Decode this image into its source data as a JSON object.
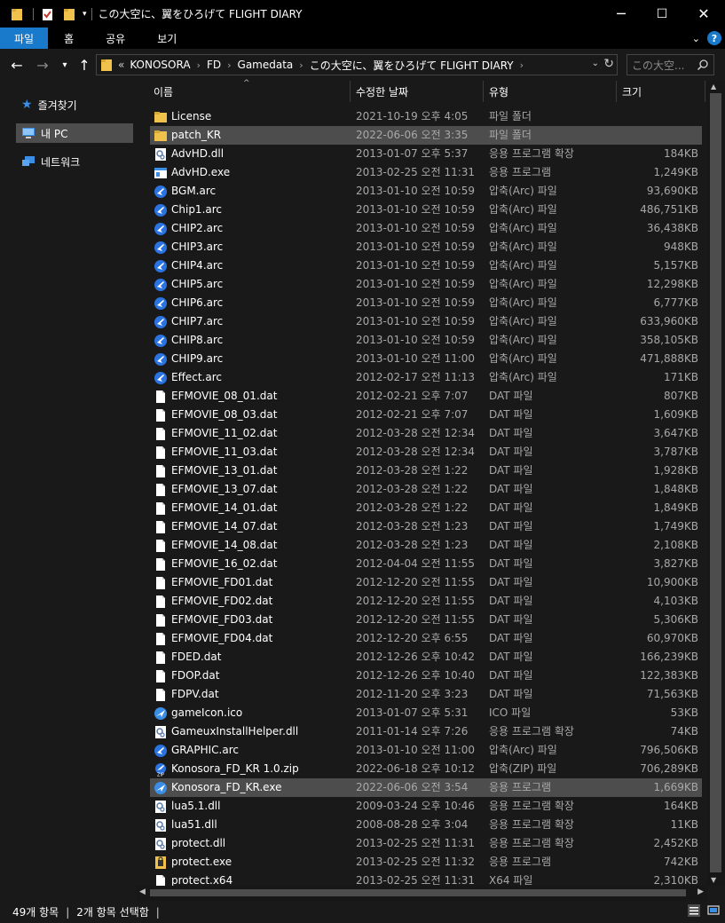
{
  "window": {
    "title": "この大空に、翼をひろげて FLIGHT DIARY",
    "minimize_glyph": "─",
    "maximize_glyph": "☐",
    "close_glyph": "✕"
  },
  "ribbon": {
    "tabs": [
      "파일",
      "홈",
      "공유",
      "보기"
    ],
    "help": "?"
  },
  "address": {
    "prefix": "«",
    "crumbs": [
      "KONOSORA",
      "FD",
      "Gamedata",
      "この大空に、翼をひろげて FLIGHT DIARY"
    ],
    "separator": "›"
  },
  "search": {
    "placeholder": "この大空..."
  },
  "nav": {
    "items": [
      {
        "label": "즐겨찾기",
        "icon": "star-icon"
      },
      {
        "label": "내 PC",
        "icon": "pc-icon"
      },
      {
        "label": "네트워크",
        "icon": "network-icon"
      }
    ]
  },
  "columns": {
    "name": "이름",
    "date": "수정한 날짜",
    "type": "유형",
    "size": "크기"
  },
  "files": [
    {
      "name": "License",
      "date": "2021-10-19 오후 4:05",
      "type": "파일 폴더",
      "size": "",
      "icon": "folder"
    },
    {
      "name": "patch_KR",
      "date": "2022-06-06 오전 3:35",
      "type": "파일 폴더",
      "size": "",
      "icon": "folder",
      "selected": true
    },
    {
      "name": "AdvHD.dll",
      "date": "2013-01-07 오후 5:37",
      "type": "응용 프로그램 확장",
      "size": "184KB",
      "icon": "dll"
    },
    {
      "name": "AdvHD.exe",
      "date": "2013-02-25 오전 11:31",
      "type": "응용 프로그램",
      "size": "1,249KB",
      "icon": "exe"
    },
    {
      "name": "BGM.arc",
      "date": "2013-01-10 오전 10:59",
      "type": "압축(Arc) 파일",
      "size": "93,690KB",
      "icon": "arc"
    },
    {
      "name": "Chip1.arc",
      "date": "2013-01-10 오전 10:59",
      "type": "압축(Arc) 파일",
      "size": "486,751KB",
      "icon": "arc"
    },
    {
      "name": "CHIP2.arc",
      "date": "2013-01-10 오전 10:59",
      "type": "압축(Arc) 파일",
      "size": "36,438KB",
      "icon": "arc"
    },
    {
      "name": "CHIP3.arc",
      "date": "2013-01-10 오전 10:59",
      "type": "압축(Arc) 파일",
      "size": "948KB",
      "icon": "arc"
    },
    {
      "name": "CHIP4.arc",
      "date": "2013-01-10 오전 10:59",
      "type": "압축(Arc) 파일",
      "size": "5,157KB",
      "icon": "arc"
    },
    {
      "name": "CHIP5.arc",
      "date": "2013-01-10 오전 10:59",
      "type": "압축(Arc) 파일",
      "size": "12,298KB",
      "icon": "arc"
    },
    {
      "name": "CHIP6.arc",
      "date": "2013-01-10 오전 10:59",
      "type": "압축(Arc) 파일",
      "size": "6,777KB",
      "icon": "arc"
    },
    {
      "name": "CHIP7.arc",
      "date": "2013-01-10 오전 10:59",
      "type": "압축(Arc) 파일",
      "size": "633,960KB",
      "icon": "arc"
    },
    {
      "name": "CHIP8.arc",
      "date": "2013-01-10 오전 10:59",
      "type": "압축(Arc) 파일",
      "size": "358,105KB",
      "icon": "arc"
    },
    {
      "name": "CHIP9.arc",
      "date": "2013-01-10 오전 11:00",
      "type": "압축(Arc) 파일",
      "size": "471,888KB",
      "icon": "arc"
    },
    {
      "name": "Effect.arc",
      "date": "2012-02-17 오전 11:13",
      "type": "압축(Arc) 파일",
      "size": "171KB",
      "icon": "arc"
    },
    {
      "name": "EFMOVIE_08_01.dat",
      "date": "2012-02-21 오후 7:07",
      "type": "DAT 파일",
      "size": "807KB",
      "icon": "file"
    },
    {
      "name": "EFMOVIE_08_03.dat",
      "date": "2012-02-21 오후 7:07",
      "type": "DAT 파일",
      "size": "1,609KB",
      "icon": "file"
    },
    {
      "name": "EFMOVIE_11_02.dat",
      "date": "2012-03-28 오전 12:34",
      "type": "DAT 파일",
      "size": "3,647KB",
      "icon": "file"
    },
    {
      "name": "EFMOVIE_11_03.dat",
      "date": "2012-03-28 오전 12:34",
      "type": "DAT 파일",
      "size": "3,787KB",
      "icon": "file"
    },
    {
      "name": "EFMOVIE_13_01.dat",
      "date": "2012-03-28 오전 1:22",
      "type": "DAT 파일",
      "size": "1,928KB",
      "icon": "file"
    },
    {
      "name": "EFMOVIE_13_07.dat",
      "date": "2012-03-28 오전 1:22",
      "type": "DAT 파일",
      "size": "1,848KB",
      "icon": "file"
    },
    {
      "name": "EFMOVIE_14_01.dat",
      "date": "2012-03-28 오전 1:22",
      "type": "DAT 파일",
      "size": "1,849KB",
      "icon": "file"
    },
    {
      "name": "EFMOVIE_14_07.dat",
      "date": "2012-03-28 오전 1:23",
      "type": "DAT 파일",
      "size": "1,749KB",
      "icon": "file"
    },
    {
      "name": "EFMOVIE_14_08.dat",
      "date": "2012-03-28 오전 1:23",
      "type": "DAT 파일",
      "size": "2,108KB",
      "icon": "file"
    },
    {
      "name": "EFMOVIE_16_02.dat",
      "date": "2012-04-04 오전 11:55",
      "type": "DAT 파일",
      "size": "3,827KB",
      "icon": "file"
    },
    {
      "name": "EFMOVIE_FD01.dat",
      "date": "2012-12-20 오전 11:55",
      "type": "DAT 파일",
      "size": "10,900KB",
      "icon": "file"
    },
    {
      "name": "EFMOVIE_FD02.dat",
      "date": "2012-12-20 오전 11:55",
      "type": "DAT 파일",
      "size": "4,103KB",
      "icon": "file"
    },
    {
      "name": "EFMOVIE_FD03.dat",
      "date": "2012-12-20 오전 11:55",
      "type": "DAT 파일",
      "size": "5,306KB",
      "icon": "file"
    },
    {
      "name": "EFMOVIE_FD04.dat",
      "date": "2012-12-20 오후 6:55",
      "type": "DAT 파일",
      "size": "60,970KB",
      "icon": "file"
    },
    {
      "name": "FDED.dat",
      "date": "2012-12-26 오후 10:42",
      "type": "DAT 파일",
      "size": "166,239KB",
      "icon": "file"
    },
    {
      "name": "FDOP.dat",
      "date": "2012-12-26 오후 10:40",
      "type": "DAT 파일",
      "size": "122,383KB",
      "icon": "file"
    },
    {
      "name": "FDPV.dat",
      "date": "2012-11-20 오후 3:23",
      "type": "DAT 파일",
      "size": "71,563KB",
      "icon": "file"
    },
    {
      "name": "gameIcon.ico",
      "date": "2013-01-07 오후 5:31",
      "type": "ICO 파일",
      "size": "53KB",
      "icon": "plane"
    },
    {
      "name": "GameuxInstallHelper.dll",
      "date": "2011-01-14 오후 7:26",
      "type": "응용 프로그램 확장",
      "size": "74KB",
      "icon": "dll"
    },
    {
      "name": "GRAPHIC.arc",
      "date": "2013-01-10 오전 11:00",
      "type": "압축(Arc) 파일",
      "size": "796,506KB",
      "icon": "arc"
    },
    {
      "name": "Konosora_FD_KR 1.0.zip",
      "date": "2022-06-18 오후 10:12",
      "type": "압축(ZIP) 파일",
      "size": "706,289KB",
      "icon": "zip"
    },
    {
      "name": "Konosora_FD_KR.exe",
      "date": "2022-06-06 오전 3:54",
      "type": "응용 프로그램",
      "size": "1,669KB",
      "icon": "plane",
      "selected": true
    },
    {
      "name": "lua5.1.dll",
      "date": "2009-03-24 오후 10:46",
      "type": "응용 프로그램 확장",
      "size": "164KB",
      "icon": "dll"
    },
    {
      "name": "lua51.dll",
      "date": "2008-08-28 오후 3:04",
      "type": "응용 프로그램 확장",
      "size": "11KB",
      "icon": "dll"
    },
    {
      "name": "protect.dll",
      "date": "2013-02-25 오전 11:31",
      "type": "응용 프로그램 확장",
      "size": "2,452KB",
      "icon": "dll"
    },
    {
      "name": "protect.exe",
      "date": "2013-02-25 오전 11:32",
      "type": "응용 프로그램",
      "size": "742KB",
      "icon": "protect"
    },
    {
      "name": "protect.x64",
      "date": "2013-02-25 오전 11:31",
      "type": "X64 파일",
      "size": "2,310KB",
      "icon": "file"
    }
  ],
  "status": {
    "count": "49개 항목",
    "selected": "2개 항목 선택함",
    "sep": "|"
  },
  "colors": {
    "accent": "#1979ca",
    "background": "#191919",
    "selection": "#4d4d4d",
    "folder": "#f0c24b",
    "arc_icon": "#2b73e0"
  }
}
